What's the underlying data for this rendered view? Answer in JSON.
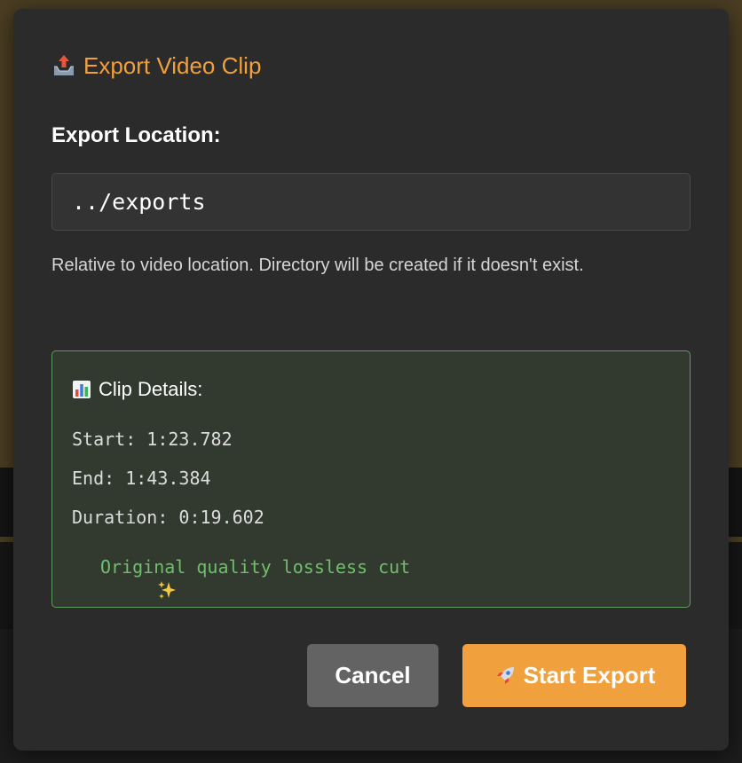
{
  "dialog": {
    "title": "Export Video Clip",
    "title_icon": "outbox-tray-icon",
    "accent_color": "#f0a03c"
  },
  "export_location": {
    "label": "Export Location:",
    "value": "../exports",
    "help_text": "Relative to video location. Directory will be created if it doesn't exist."
  },
  "clip_details": {
    "title": "Clip Details:",
    "title_icon": "bar-chart-icon",
    "start": "Start: 1:23.782",
    "end": "End: 1:43.384",
    "duration": "Duration: 0:19.602",
    "quality_icon": "sparkles-icon",
    "quality_note": "Original quality lossless cut",
    "border_color": "#5e9a5c",
    "quality_color": "#6fbf6a"
  },
  "actions": {
    "cancel_label": "Cancel",
    "export_label": "Start Export",
    "export_icon": "rocket-icon"
  }
}
